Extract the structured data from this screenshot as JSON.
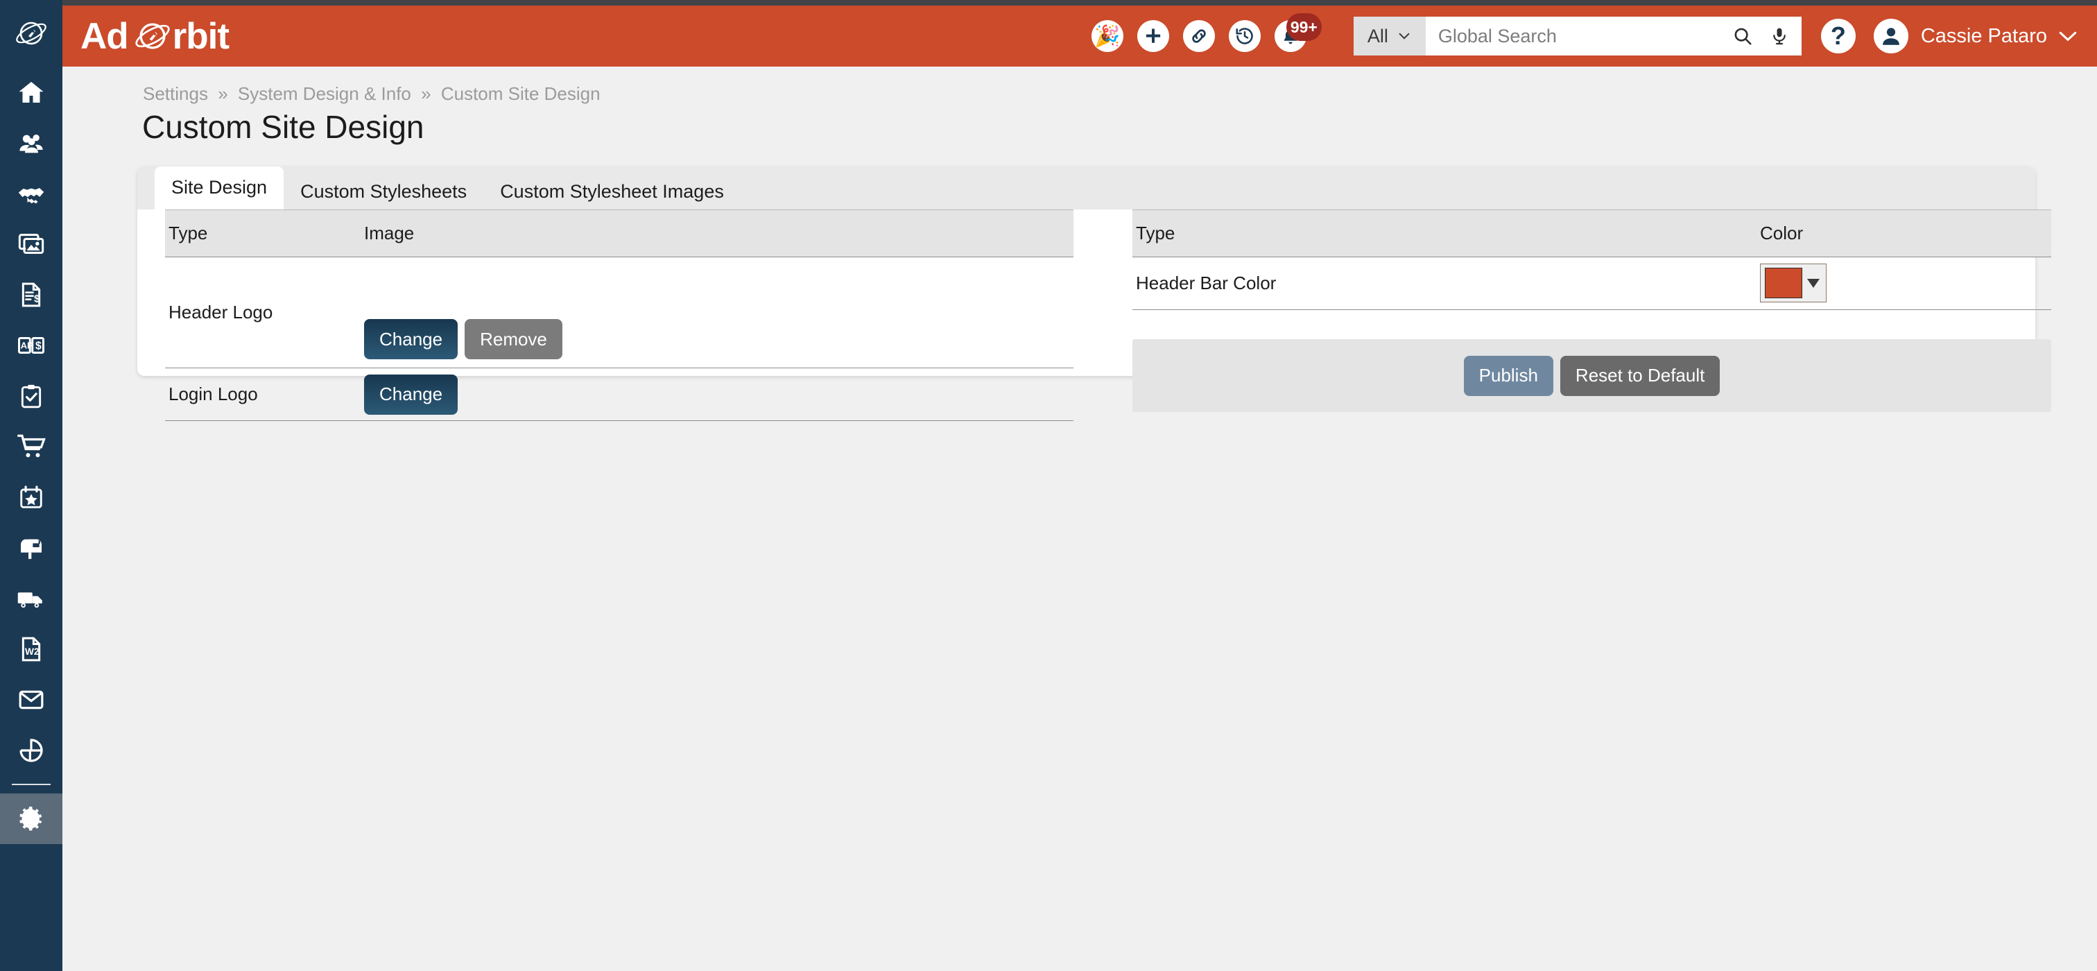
{
  "app": {
    "brand_name": "Ad Orbit",
    "brand_prefix": "Ad",
    "brand_suffix": "rbit",
    "accent_color": "#cb4b2b",
    "sidebar_color": "#1b3953",
    "top_strip_color": "#404448"
  },
  "header": {
    "icons": [
      {
        "name": "celebration-icon",
        "glyph": "🎉",
        "label": "Celebration"
      },
      {
        "name": "add-icon",
        "glyph": "+",
        "label": "Add"
      },
      {
        "name": "link-icon",
        "glyph": "link",
        "label": "Links"
      },
      {
        "name": "history-icon",
        "glyph": "history",
        "label": "History"
      },
      {
        "name": "notification-bell-icon",
        "glyph": "bell",
        "label": "Notifications"
      }
    ],
    "notification_badge": "99+",
    "search": {
      "scope_label": "All",
      "placeholder": "Global Search",
      "value": "",
      "search_icon": "search-icon",
      "mic_icon": "microphone-icon"
    },
    "help_label": "?",
    "user_name": "Cassie Pataro"
  },
  "sidebar": {
    "logo_name": "ad-orbit-planet-logo",
    "items": [
      {
        "name": "sidebar-item-home",
        "label": "Home",
        "icon": "home-icon",
        "active": false
      },
      {
        "name": "sidebar-item-contacts",
        "label": "Contacts",
        "icon": "people-icon",
        "active": false
      },
      {
        "name": "sidebar-item-deals",
        "label": "Deals",
        "icon": "handshake-icon",
        "active": false
      },
      {
        "name": "sidebar-item-media",
        "label": "Media",
        "icon": "images-icon",
        "active": false
      },
      {
        "name": "sidebar-item-invoices",
        "label": "Invoices",
        "icon": "invoice-icon",
        "active": false
      },
      {
        "name": "sidebar-item-payments",
        "label": "Payments",
        "icon": "ledger-icon",
        "active": false
      },
      {
        "name": "sidebar-item-tasks",
        "label": "Tasks",
        "icon": "clipboard-check-icon",
        "active": false
      },
      {
        "name": "sidebar-item-orders",
        "label": "Orders",
        "icon": "cart-icon",
        "active": false
      },
      {
        "name": "sidebar-item-events",
        "label": "Events",
        "icon": "calendar-star-icon",
        "active": false
      },
      {
        "name": "sidebar-item-circulation",
        "label": "Circulation",
        "icon": "mailbox-icon",
        "active": false
      },
      {
        "name": "sidebar-item-distribution",
        "label": "Distribution",
        "icon": "truck-icon",
        "active": false
      },
      {
        "name": "sidebar-item-tax-forms",
        "label": "Tax Forms",
        "icon": "w2-document-icon",
        "active": false
      },
      {
        "name": "sidebar-item-email",
        "label": "Email",
        "icon": "envelope-icon",
        "active": false
      },
      {
        "name": "sidebar-item-reports",
        "label": "Reports",
        "icon": "pie-chart-icon",
        "active": false
      },
      {
        "name": "sidebar-item-settings",
        "label": "Settings",
        "icon": "gear-icon",
        "active": true
      }
    ]
  },
  "breadcrumb": {
    "items": [
      "Settings",
      "System Design & Info",
      "Custom Site Design"
    ],
    "separator": "»"
  },
  "page": {
    "title": "Custom Site Design"
  },
  "tabs": [
    {
      "label": "Site Design",
      "active": true
    },
    {
      "label": "Custom Stylesheets",
      "active": false
    },
    {
      "label": "Custom Stylesheet Images",
      "active": false
    }
  ],
  "images_table": {
    "headers": [
      "Type",
      "Image"
    ],
    "rows": [
      {
        "type": "Header Logo",
        "buttons": [
          {
            "label": "Change",
            "style": "primary"
          },
          {
            "label": "Remove",
            "style": "grey"
          }
        ]
      },
      {
        "type": "Login Logo",
        "buttons": [
          {
            "label": "Change",
            "style": "primary"
          }
        ]
      }
    ]
  },
  "colors_table": {
    "headers": [
      "Type",
      "Color"
    ],
    "rows": [
      {
        "type": "Header Bar Color",
        "swatch_color": "#cb4b2b",
        "control": "color-picker-dropdown"
      }
    ]
  },
  "actions": {
    "publish_label": "Publish",
    "reset_label": "Reset to Default"
  }
}
